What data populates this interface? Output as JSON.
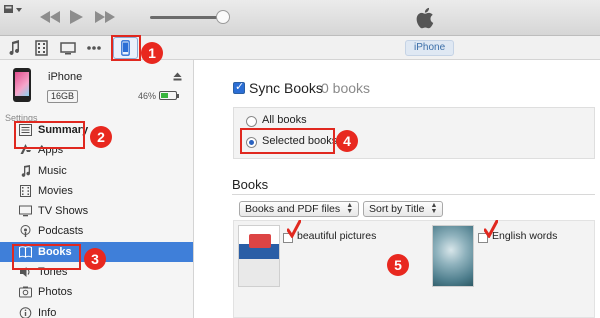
{
  "device": {
    "name": "iPhone",
    "capacity": "16GB",
    "battery": "46%",
    "pill_label": "iPhone"
  },
  "sidebar": {
    "section_label": "Settings",
    "items": [
      {
        "label": "Summary",
        "icon": "summary-icon"
      },
      {
        "label": "Apps",
        "icon": "apps-icon"
      },
      {
        "label": "Music",
        "icon": "music-icon"
      },
      {
        "label": "Movies",
        "icon": "movies-icon"
      },
      {
        "label": "TV Shows",
        "icon": "tv-icon"
      },
      {
        "label": "Podcasts",
        "icon": "podcasts-icon"
      },
      {
        "label": "Books",
        "icon": "books-icon",
        "active": true
      },
      {
        "label": "Tones",
        "icon": "tones-icon"
      },
      {
        "label": "Photos",
        "icon": "photos-icon"
      },
      {
        "label": "Info",
        "icon": "info-icon"
      }
    ]
  },
  "sync": {
    "label": "Sync Books",
    "count": "0 books",
    "checked": true,
    "options": [
      "All books",
      "Selected books"
    ],
    "selected_option": "Selected books"
  },
  "books": {
    "heading": "Books",
    "filter": "Books and PDF files",
    "sort": "Sort by Title",
    "items": [
      {
        "title": "beautiful pictures"
      },
      {
        "title": "English words"
      }
    ]
  },
  "markers": [
    "1",
    "2",
    "3",
    "4",
    "5"
  ],
  "colors": {
    "accent": "#3f7fd9",
    "annotation": "#e8281f"
  }
}
